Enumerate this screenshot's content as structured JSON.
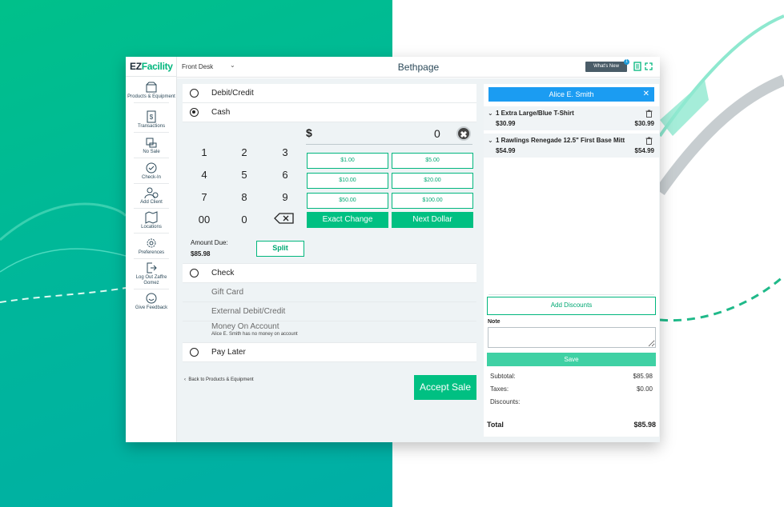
{
  "brand": {
    "logo_ez": "EZ",
    "logo_facility": "Facility",
    "accent": "#00b67d",
    "client_color": "#1b9cf2"
  },
  "sidebar": {
    "items": [
      {
        "label": "Products & Equipment",
        "icon": "box-icon"
      },
      {
        "label": "Transactions",
        "icon": "receipt-icon"
      },
      {
        "label": "No Sale",
        "icon": "register-icon"
      },
      {
        "label": "Check-In",
        "icon": "checkin-icon"
      },
      {
        "label": "Add Client",
        "icon": "add-client-icon"
      },
      {
        "label": "Locations",
        "icon": "map-icon"
      },
      {
        "label": "Preferences",
        "icon": "gear-icon"
      },
      {
        "label": "Log Out Zaffre Gomez",
        "icon": "logout-icon"
      },
      {
        "label": "Give Feedback",
        "icon": "feedback-icon"
      }
    ]
  },
  "header": {
    "location_select": "Front Desk",
    "title": "Bethpage",
    "whats_new": "What's New",
    "whats_new_badge": "1"
  },
  "payment": {
    "debit_credit": "Debit/Credit",
    "cash": "Cash",
    "currency_symbol": "$",
    "amount": "0",
    "clear_symbol": "✖",
    "keypad": [
      "1",
      "2",
      "3",
      "4",
      "5",
      "6",
      "7",
      "8",
      "9",
      "00",
      "0"
    ],
    "quick_amounts": [
      "$1.00",
      "$5.00",
      "$10.00",
      "$20.00",
      "$50.00",
      "$100.00"
    ],
    "exact_change": "Exact Change",
    "next_dollar": "Next Dollar",
    "amount_due_label": "Amount Due:",
    "amount_due_value": "$85.98",
    "split": "Split",
    "check": "Check",
    "gift_card": "Gift Card",
    "external": "External Debit/Credit",
    "money_on_account": "Money On Account",
    "money_on_account_note": "Alice E. Smith has no money on account",
    "pay_later": "Pay Later",
    "back": "Back to Products & Equipment",
    "accept": "Accept Sale"
  },
  "cart": {
    "client": "Alice E. Smith",
    "client_close": "✕",
    "items": [
      {
        "name": "1  Extra Large/Blue T-Shirt",
        "unit_price": "$30.99",
        "total": "$30.99"
      },
      {
        "name": "1  Rawlings Renegade 12.5\" First Base Mitt",
        "unit_price": "$54.99",
        "total": "$54.99"
      }
    ],
    "add_discounts": "Add Discounts",
    "note_label": "Note",
    "save": "Save",
    "subtotal_label": "Subtotal:",
    "subtotal": "$85.98",
    "taxes_label": "Taxes:",
    "taxes": "$0.00",
    "discounts_label": "Discounts:",
    "total_label": "Total",
    "total": "$85.98"
  }
}
